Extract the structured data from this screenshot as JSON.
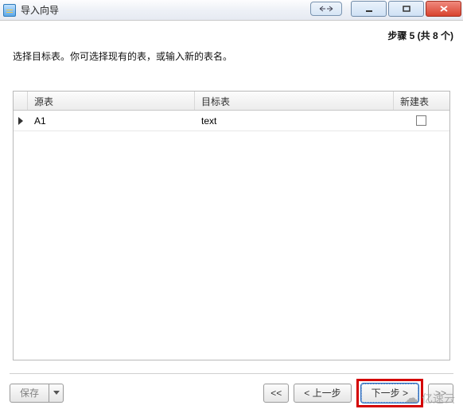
{
  "window": {
    "title": "导入向导"
  },
  "wizard": {
    "step_label": "步骤 5 (共 8 个)",
    "instruction": "选择目标表。你可选择现有的表，或输入新的表名。"
  },
  "table": {
    "headers": {
      "source": "源表",
      "target": "目标表",
      "new": "新建表"
    },
    "rows": [
      {
        "source": "A1",
        "target": "text",
        "new_table": false
      }
    ]
  },
  "buttons": {
    "save": "保存",
    "first": "<<",
    "prev": "< 上一步",
    "next": "下一步 >",
    "last": ">>"
  },
  "watermark": "亿速云"
}
